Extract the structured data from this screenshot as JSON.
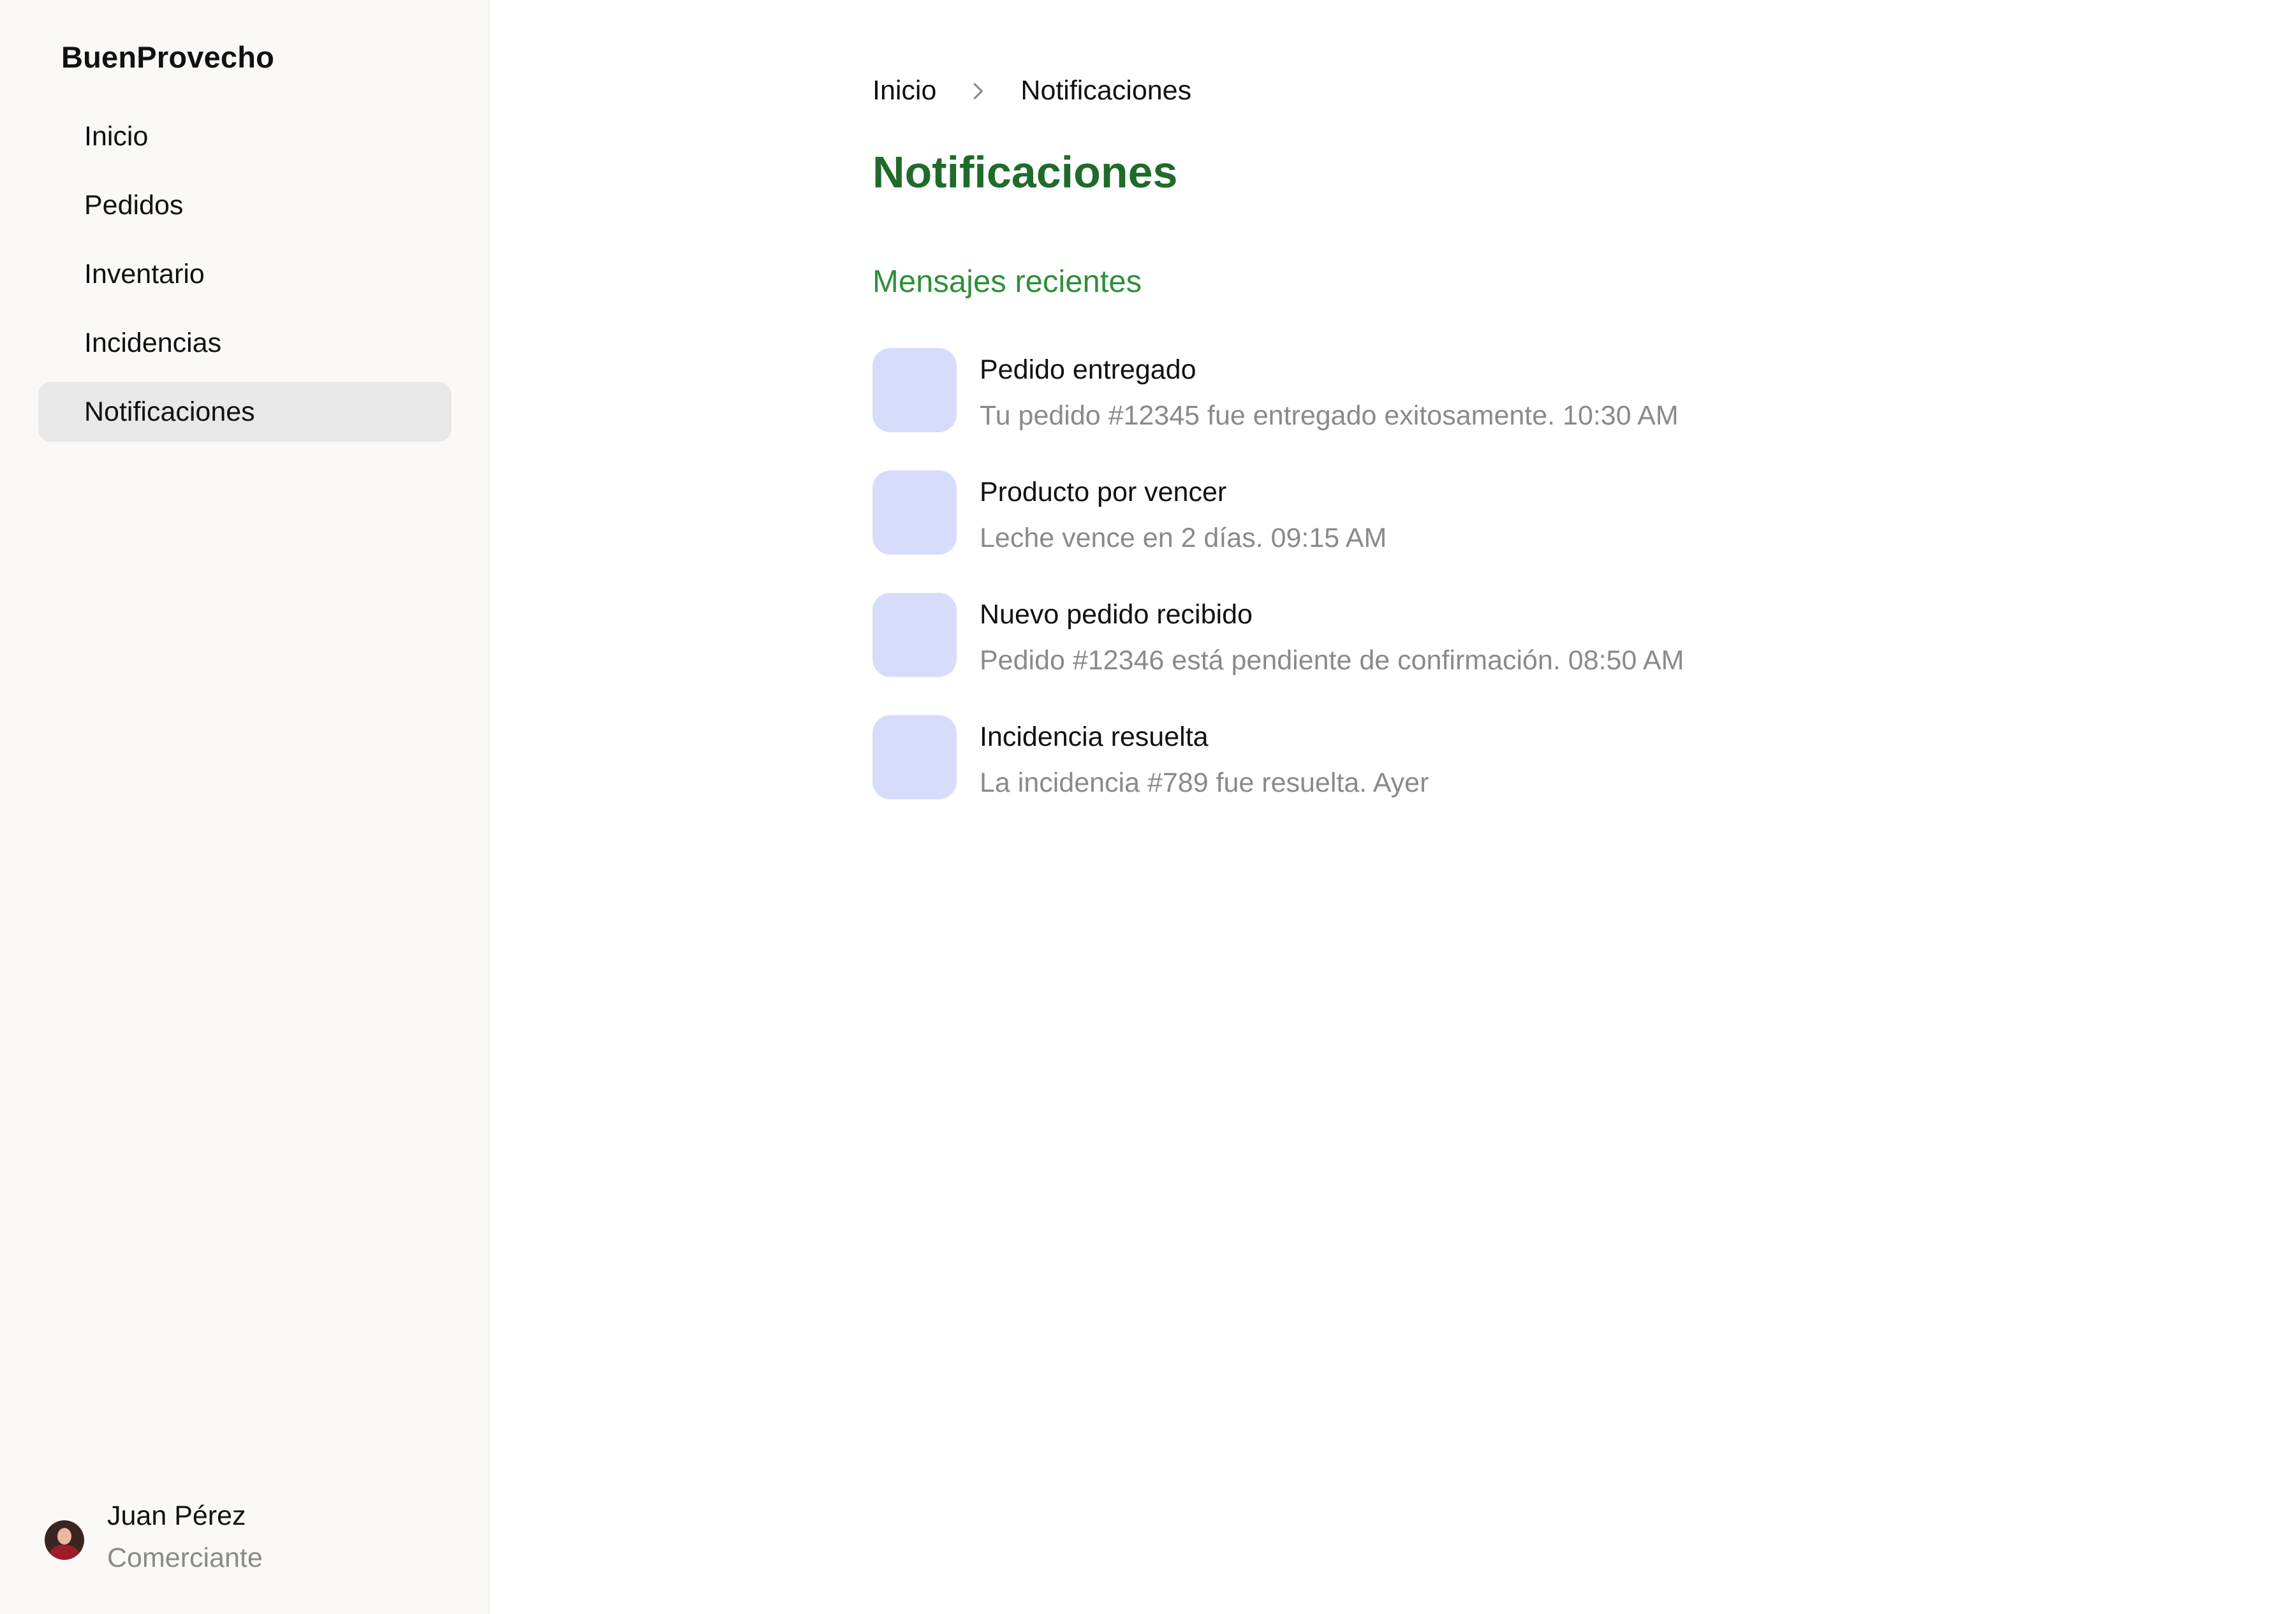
{
  "sidebar": {
    "brand": "BuenProvecho",
    "items": [
      {
        "label": "Inicio",
        "active": false
      },
      {
        "label": "Pedidos",
        "active": false
      },
      {
        "label": "Inventario",
        "active": false
      },
      {
        "label": "Incidencias",
        "active": false
      },
      {
        "label": "Notificaciones",
        "active": true
      }
    ],
    "user": {
      "name": "Juan Pérez",
      "role": "Comerciante"
    }
  },
  "breadcrumb": {
    "items": [
      "Inicio",
      "Notificaciones"
    ],
    "separator_icon": "chevron-right-icon"
  },
  "page": {
    "title": "Notificaciones",
    "section_title": "Mensajes recientes"
  },
  "notifications": [
    {
      "title": "Pedido entregado",
      "description": "Tu pedido #12345 fue entregado exitosamente. 10:30 AM"
    },
    {
      "title": "Producto por vencer",
      "description": "Leche vence en 2 días. 09:15 AM"
    },
    {
      "title": "Nuevo pedido recibido",
      "description": "Pedido #12346 está pendiente de confirmación. 08:50 AM"
    },
    {
      "title": "Incidencia resuelta",
      "description": "La incidencia #789 fue resuelta. Ayer"
    }
  ],
  "colors": {
    "title_green": "#1e6b2a",
    "section_green": "#2f8f3a",
    "icon_placeholder": "#d7dcfb",
    "sidebar_bg": "#faf9f7",
    "active_item_bg": "#e8e8e8",
    "muted_text": "#8a8a8a"
  }
}
